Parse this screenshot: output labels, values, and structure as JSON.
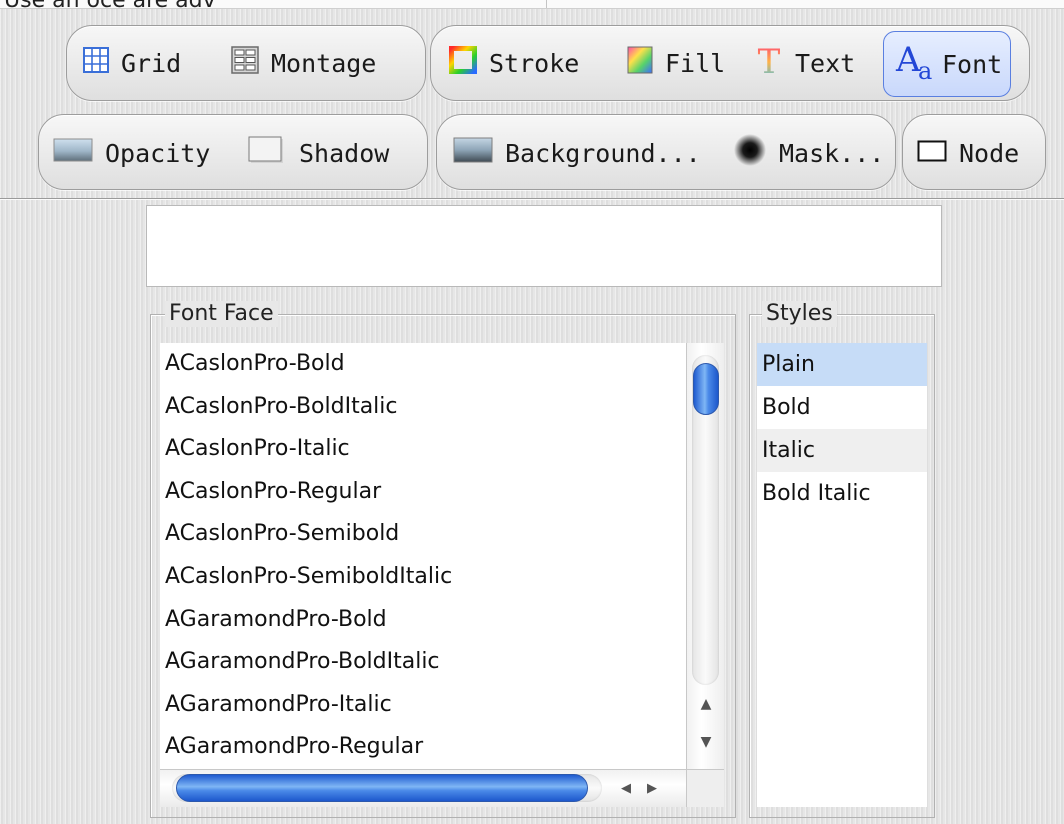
{
  "header_partial_text": "Use an oce are adv",
  "toolbar": {
    "row1": {
      "grid": {
        "label": "Grid",
        "icon": "grid-icon"
      },
      "montage": {
        "label": "Montage",
        "icon": "montage-icon"
      },
      "stroke": {
        "label": "Stroke",
        "icon": "stroke-icon"
      },
      "fill": {
        "label": "Fill",
        "icon": "fill-icon"
      },
      "text": {
        "label": "Text",
        "icon": "text-icon",
        "glyph": "T"
      },
      "font": {
        "label": "Font",
        "icon": "font-icon",
        "glyph_big": "A",
        "glyph_small": "a",
        "selected": true
      }
    },
    "row2": {
      "opacity": {
        "label": "Opacity",
        "icon": "opacity-icon"
      },
      "shadow": {
        "label": "Shadow",
        "icon": "shadow-icon"
      },
      "background": {
        "label": "Background...",
        "icon": "background-icon"
      },
      "mask": {
        "label": "Mask...",
        "icon": "mask-icon"
      },
      "node": {
        "label": "Node",
        "icon": "node-icon"
      }
    }
  },
  "preview": {
    "text": ""
  },
  "font_face": {
    "title": "Font Face",
    "items": [
      "ACaslonPro-Bold",
      "ACaslonPro-BoldItalic",
      "ACaslonPro-Italic",
      "ACaslonPro-Regular",
      "ACaslonPro-Semibold",
      "ACaslonPro-SemiboldItalic",
      "AGaramondPro-Bold",
      "AGaramondPro-BoldItalic",
      "AGaramondPro-Italic",
      "AGaramondPro-Regular"
    ],
    "scroll_up_arrow": "▲",
    "scroll_down_arrow": "▼",
    "scroll_left_arrow": "◀",
    "scroll_right_arrow": "▶"
  },
  "styles": {
    "title": "Styles",
    "items": [
      "Plain",
      "Bold",
      "Italic",
      "Bold Italic"
    ],
    "selected_index": 0,
    "hover_index": 2
  },
  "colors": {
    "selection_blue": "#c6dcf7",
    "scroll_thumb": "#4b8ae8",
    "selected_button_border": "#5a7fe0"
  }
}
